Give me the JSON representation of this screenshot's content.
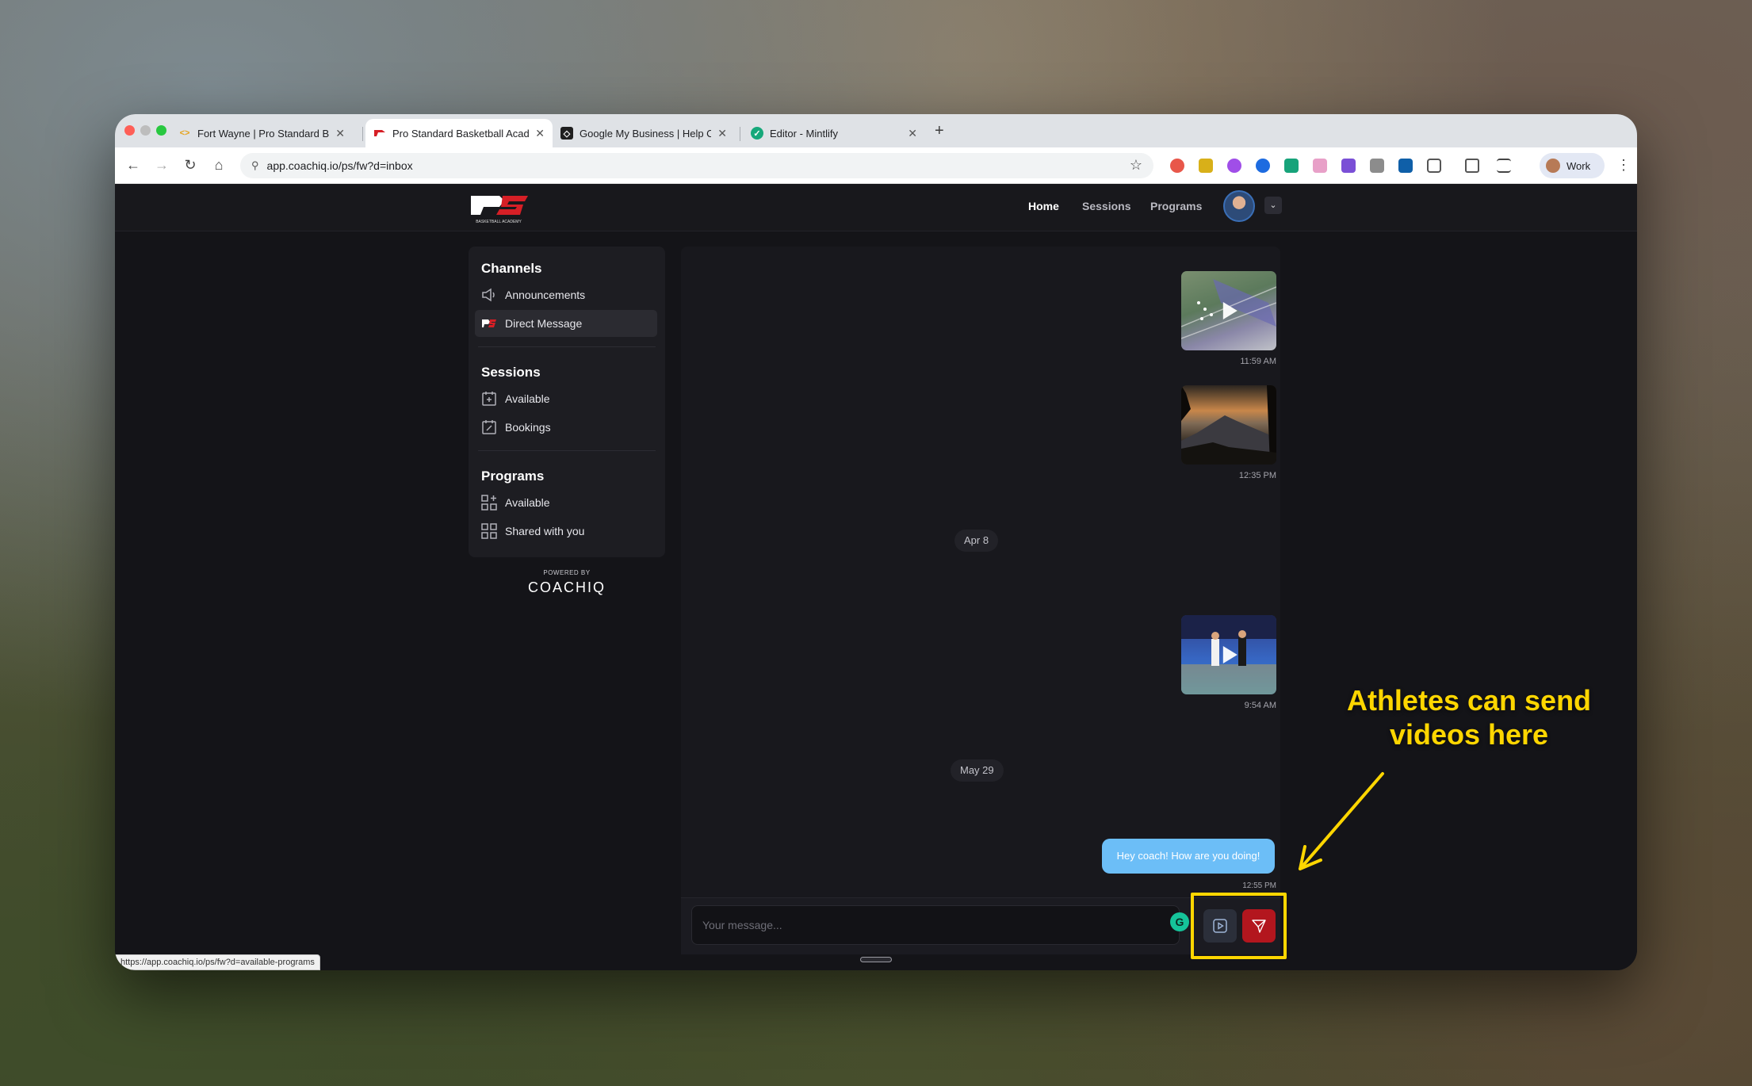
{
  "browser": {
    "tabs": [
      {
        "title": "Fort Wayne | Pro Standard Ba",
        "favicon": "code-diamond-icon",
        "active": false
      },
      {
        "title": "Pro Standard Basketball Acad",
        "favicon": "ps-logo-icon",
        "active": true
      },
      {
        "title": "Google My Business | Help C",
        "favicon": "square-logo-icon",
        "active": false
      },
      {
        "title": "Editor - Mintlify",
        "favicon": "leaf-icon",
        "active": false
      }
    ],
    "url": "app.coachiq.io/ps/fw?d=inbox",
    "profile_label": "Work",
    "status_url": "https://app.coachiq.io/ps/fw?d=available-programs"
  },
  "header": {
    "nav": [
      {
        "label": "Home",
        "active": true
      },
      {
        "label": "Sessions",
        "active": false
      },
      {
        "label": "Programs",
        "active": false
      }
    ],
    "logo_text": "PS",
    "logo_subtext": "BASKETBALL ACADEMY"
  },
  "sidebar": {
    "channels_title": "Channels",
    "channels": [
      {
        "label": "Announcements",
        "icon": "megaphone-icon"
      },
      {
        "label": "Direct Message",
        "icon": "ps-logo-icon",
        "selected": true
      }
    ],
    "sessions_title": "Sessions",
    "sessions": [
      {
        "label": "Available",
        "icon": "calendar-plus-icon"
      },
      {
        "label": "Bookings",
        "icon": "calendar-edit-icon"
      }
    ],
    "programs_title": "Programs",
    "programs": [
      {
        "label": "Available",
        "icon": "grid-plus-icon"
      },
      {
        "label": "Shared with you",
        "icon": "grid-share-icon"
      }
    ],
    "powered_by": "POWERED BY",
    "brand": "COACHIQ"
  },
  "messages": [
    {
      "type": "video",
      "thumbnail": "football-field",
      "time": "11:59 AM"
    },
    {
      "type": "image",
      "thumbnail": "sunset-volcano",
      "time": "12:35 PM"
    },
    {
      "type": "date",
      "label": "Apr 8"
    },
    {
      "type": "video",
      "thumbnail": "wrestling-mat",
      "time": "9:54 AM"
    },
    {
      "type": "date",
      "label": "May 29"
    },
    {
      "type": "text",
      "text": "Hey coach! How are you doing!",
      "time": "12:55 PM"
    }
  ],
  "composer": {
    "placeholder": "Your message...",
    "grammarly_label": "G"
  },
  "callout": {
    "line1": "Athletes can send",
    "line2": "videos here"
  },
  "colors": {
    "accent_red": "#b3161e",
    "bubble_blue": "#6cbef7",
    "highlight_yellow": "#ffd600"
  }
}
